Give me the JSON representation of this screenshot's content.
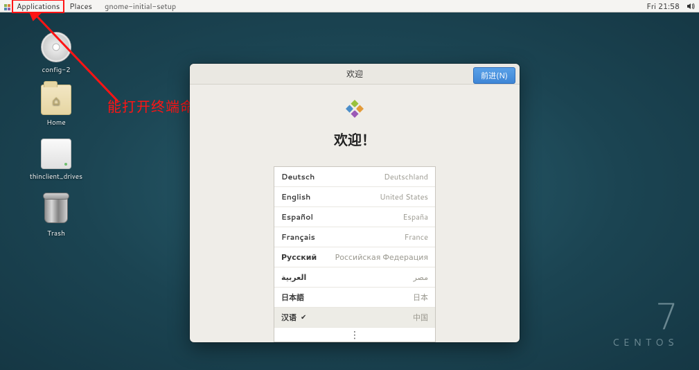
{
  "panel": {
    "applications": "Applications",
    "places": "Places",
    "app": "gnome-initial-setup",
    "clock": "Fri 21:58"
  },
  "desktop": {
    "config2": "config-2",
    "home": "Home",
    "thinclient": "thinclient_drives",
    "trash": "Trash"
  },
  "annotation": {
    "text": "能打开终端命令窗口"
  },
  "watermark": {
    "seven": "7",
    "name": "CENTOS"
  },
  "dialog": {
    "title": "欢迎",
    "next": "前进(N)",
    "welcome": "欢迎！",
    "more": "⋮",
    "langs": [
      {
        "name": "Deutsch",
        "country": "Deutschland",
        "selected": false
      },
      {
        "name": "English",
        "country": "United States",
        "selected": false
      },
      {
        "name": "Español",
        "country": "España",
        "selected": false
      },
      {
        "name": "Français",
        "country": "France",
        "selected": false
      },
      {
        "name": "Русский",
        "country": "Российская Федерация",
        "selected": false
      },
      {
        "name": "العربية",
        "country": "مصر",
        "selected": false
      },
      {
        "name": "日本語",
        "country": "日本",
        "selected": false
      },
      {
        "name": "汉语",
        "country": "中国",
        "selected": true
      }
    ]
  }
}
